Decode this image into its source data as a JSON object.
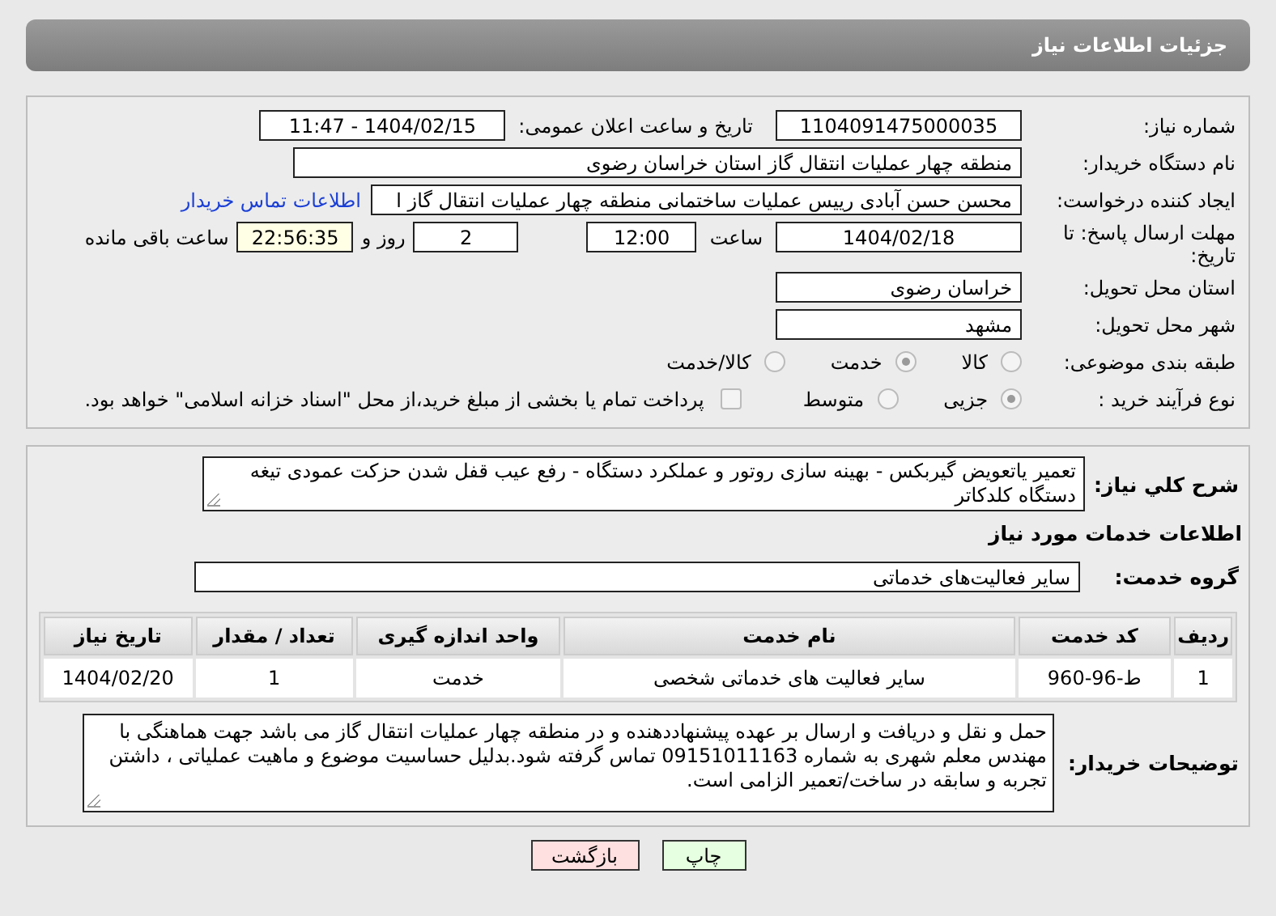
{
  "header": {
    "title": "جزئیات اطلاعات نیاز"
  },
  "need_number": {
    "label": "شماره نیاز:",
    "value": "1104091475000035"
  },
  "announce": {
    "label": "تاریخ و ساعت اعلان عمومی:",
    "value": "1404/02/15 - 11:47"
  },
  "buyer_org": {
    "label": "نام دستگاه خریدار:",
    "value": "منطقه چهار عملیات انتقال گاز   استان خراسان رضوی"
  },
  "requester": {
    "label": "ایجاد کننده درخواست:",
    "value": "محسن حسن آبادی رییس عملیات ساختمانی منطقه چهار عملیات انتقال گاز  ا",
    "link": "اطلاعات تماس خریدار"
  },
  "deadline": {
    "label": "مهلت ارسال پاسخ: تا تاریخ:",
    "date": "1404/02/18",
    "time_label": "ساعت",
    "time": "12:00",
    "days": "2",
    "days_label": "روز و",
    "remaining": "22:56:35",
    "remaining_label": "ساعت باقی مانده"
  },
  "province": {
    "label": "استان محل تحویل:",
    "value": "خراسان رضوی"
  },
  "city": {
    "label": "شهر محل تحویل:",
    "value": "مشهد"
  },
  "category": {
    "label": "طبقه بندی موضوعی:",
    "options": [
      {
        "label": "کالا",
        "selected": false
      },
      {
        "label": "خدمت",
        "selected": true
      },
      {
        "label": "کالا/خدمت",
        "selected": false
      }
    ]
  },
  "process": {
    "label": "نوع فرآیند خرید :",
    "options": [
      {
        "label": "جزیی",
        "selected": true
      },
      {
        "label": "متوسط",
        "selected": false
      }
    ],
    "payment": {
      "label": "پرداخت تمام یا بخشی از مبلغ خرید،از محل \"اسناد خزانه اسلامی\" خواهد بود.",
      "checked": false
    }
  },
  "description": {
    "label": "شرح کلي نياز:",
    "value": "تعمیر یاتعویض گیربکس - بهینه سازی روتور و عملکرد دستگاه - رفع عیب قفل شدن حزکت عمودی تیغه دستگاه کلدکاتر"
  },
  "services_heading": "اطلاعات خدمات مورد نیاز",
  "service_group": {
    "label": "گروه خدمت:",
    "value": "سایر فعالیت‌های خدماتی"
  },
  "table": {
    "columns": [
      "ردیف",
      "کد خدمت",
      "نام خدمت",
      "واحد اندازه گیری",
      "تعداد / مقدار",
      "تاریخ نیاز"
    ],
    "rows": [
      [
        "1",
        "ط-96-960",
        "سایر فعالیت های خدماتی شخصی",
        "خدمت",
        "1",
        "1404/02/20"
      ]
    ]
  },
  "buyer_notes": {
    "label": "توضیحات خریدار:",
    "value": "حمل و نقل و دریافت و ارسال بر عهده پیشنهاددهنده و در منطقه چهار عملیات انتقال گاز می باشد جهت هماهنگی با مهندس معلم شهری به شماره 09151011163 تماس گرفته شود.بدلیل حساسیت موضوع و ماهیت عملیاتی ، داشتن تجربه و سابقه در ساخت/تعمیر الزامی است."
  },
  "buttons": [
    {
      "label": "چاپ",
      "kind": "print"
    },
    {
      "label": "بازگشت",
      "kind": "back"
    }
  ]
}
